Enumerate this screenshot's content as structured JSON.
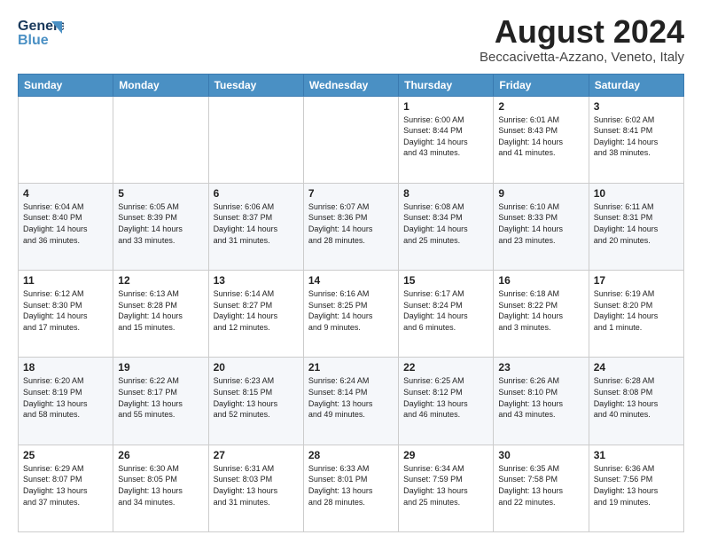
{
  "header": {
    "logo_line1": "General",
    "logo_line2": "Blue",
    "month_title": "August 2024",
    "subtitle": "Beccacivetta-Azzano, Veneto, Italy"
  },
  "weekdays": [
    "Sunday",
    "Monday",
    "Tuesday",
    "Wednesday",
    "Thursday",
    "Friday",
    "Saturday"
  ],
  "weeks": [
    [
      {
        "day": "",
        "info": ""
      },
      {
        "day": "",
        "info": ""
      },
      {
        "day": "",
        "info": ""
      },
      {
        "day": "",
        "info": ""
      },
      {
        "day": "1",
        "info": "Sunrise: 6:00 AM\nSunset: 8:44 PM\nDaylight: 14 hours\nand 43 minutes."
      },
      {
        "day": "2",
        "info": "Sunrise: 6:01 AM\nSunset: 8:43 PM\nDaylight: 14 hours\nand 41 minutes."
      },
      {
        "day": "3",
        "info": "Sunrise: 6:02 AM\nSunset: 8:41 PM\nDaylight: 14 hours\nand 38 minutes."
      }
    ],
    [
      {
        "day": "4",
        "info": "Sunrise: 6:04 AM\nSunset: 8:40 PM\nDaylight: 14 hours\nand 36 minutes."
      },
      {
        "day": "5",
        "info": "Sunrise: 6:05 AM\nSunset: 8:39 PM\nDaylight: 14 hours\nand 33 minutes."
      },
      {
        "day": "6",
        "info": "Sunrise: 6:06 AM\nSunset: 8:37 PM\nDaylight: 14 hours\nand 31 minutes."
      },
      {
        "day": "7",
        "info": "Sunrise: 6:07 AM\nSunset: 8:36 PM\nDaylight: 14 hours\nand 28 minutes."
      },
      {
        "day": "8",
        "info": "Sunrise: 6:08 AM\nSunset: 8:34 PM\nDaylight: 14 hours\nand 25 minutes."
      },
      {
        "day": "9",
        "info": "Sunrise: 6:10 AM\nSunset: 8:33 PM\nDaylight: 14 hours\nand 23 minutes."
      },
      {
        "day": "10",
        "info": "Sunrise: 6:11 AM\nSunset: 8:31 PM\nDaylight: 14 hours\nand 20 minutes."
      }
    ],
    [
      {
        "day": "11",
        "info": "Sunrise: 6:12 AM\nSunset: 8:30 PM\nDaylight: 14 hours\nand 17 minutes."
      },
      {
        "day": "12",
        "info": "Sunrise: 6:13 AM\nSunset: 8:28 PM\nDaylight: 14 hours\nand 15 minutes."
      },
      {
        "day": "13",
        "info": "Sunrise: 6:14 AM\nSunset: 8:27 PM\nDaylight: 14 hours\nand 12 minutes."
      },
      {
        "day": "14",
        "info": "Sunrise: 6:16 AM\nSunset: 8:25 PM\nDaylight: 14 hours\nand 9 minutes."
      },
      {
        "day": "15",
        "info": "Sunrise: 6:17 AM\nSunset: 8:24 PM\nDaylight: 14 hours\nand 6 minutes."
      },
      {
        "day": "16",
        "info": "Sunrise: 6:18 AM\nSunset: 8:22 PM\nDaylight: 14 hours\nand 3 minutes."
      },
      {
        "day": "17",
        "info": "Sunrise: 6:19 AM\nSunset: 8:20 PM\nDaylight: 14 hours\nand 1 minute."
      }
    ],
    [
      {
        "day": "18",
        "info": "Sunrise: 6:20 AM\nSunset: 8:19 PM\nDaylight: 13 hours\nand 58 minutes."
      },
      {
        "day": "19",
        "info": "Sunrise: 6:22 AM\nSunset: 8:17 PM\nDaylight: 13 hours\nand 55 minutes."
      },
      {
        "day": "20",
        "info": "Sunrise: 6:23 AM\nSunset: 8:15 PM\nDaylight: 13 hours\nand 52 minutes."
      },
      {
        "day": "21",
        "info": "Sunrise: 6:24 AM\nSunset: 8:14 PM\nDaylight: 13 hours\nand 49 minutes."
      },
      {
        "day": "22",
        "info": "Sunrise: 6:25 AM\nSunset: 8:12 PM\nDaylight: 13 hours\nand 46 minutes."
      },
      {
        "day": "23",
        "info": "Sunrise: 6:26 AM\nSunset: 8:10 PM\nDaylight: 13 hours\nand 43 minutes."
      },
      {
        "day": "24",
        "info": "Sunrise: 6:28 AM\nSunset: 8:08 PM\nDaylight: 13 hours\nand 40 minutes."
      }
    ],
    [
      {
        "day": "25",
        "info": "Sunrise: 6:29 AM\nSunset: 8:07 PM\nDaylight: 13 hours\nand 37 minutes."
      },
      {
        "day": "26",
        "info": "Sunrise: 6:30 AM\nSunset: 8:05 PM\nDaylight: 13 hours\nand 34 minutes."
      },
      {
        "day": "27",
        "info": "Sunrise: 6:31 AM\nSunset: 8:03 PM\nDaylight: 13 hours\nand 31 minutes."
      },
      {
        "day": "28",
        "info": "Sunrise: 6:33 AM\nSunset: 8:01 PM\nDaylight: 13 hours\nand 28 minutes."
      },
      {
        "day": "29",
        "info": "Sunrise: 6:34 AM\nSunset: 7:59 PM\nDaylight: 13 hours\nand 25 minutes."
      },
      {
        "day": "30",
        "info": "Sunrise: 6:35 AM\nSunset: 7:58 PM\nDaylight: 13 hours\nand 22 minutes."
      },
      {
        "day": "31",
        "info": "Sunrise: 6:36 AM\nSunset: 7:56 PM\nDaylight: 13 hours\nand 19 minutes."
      }
    ]
  ]
}
